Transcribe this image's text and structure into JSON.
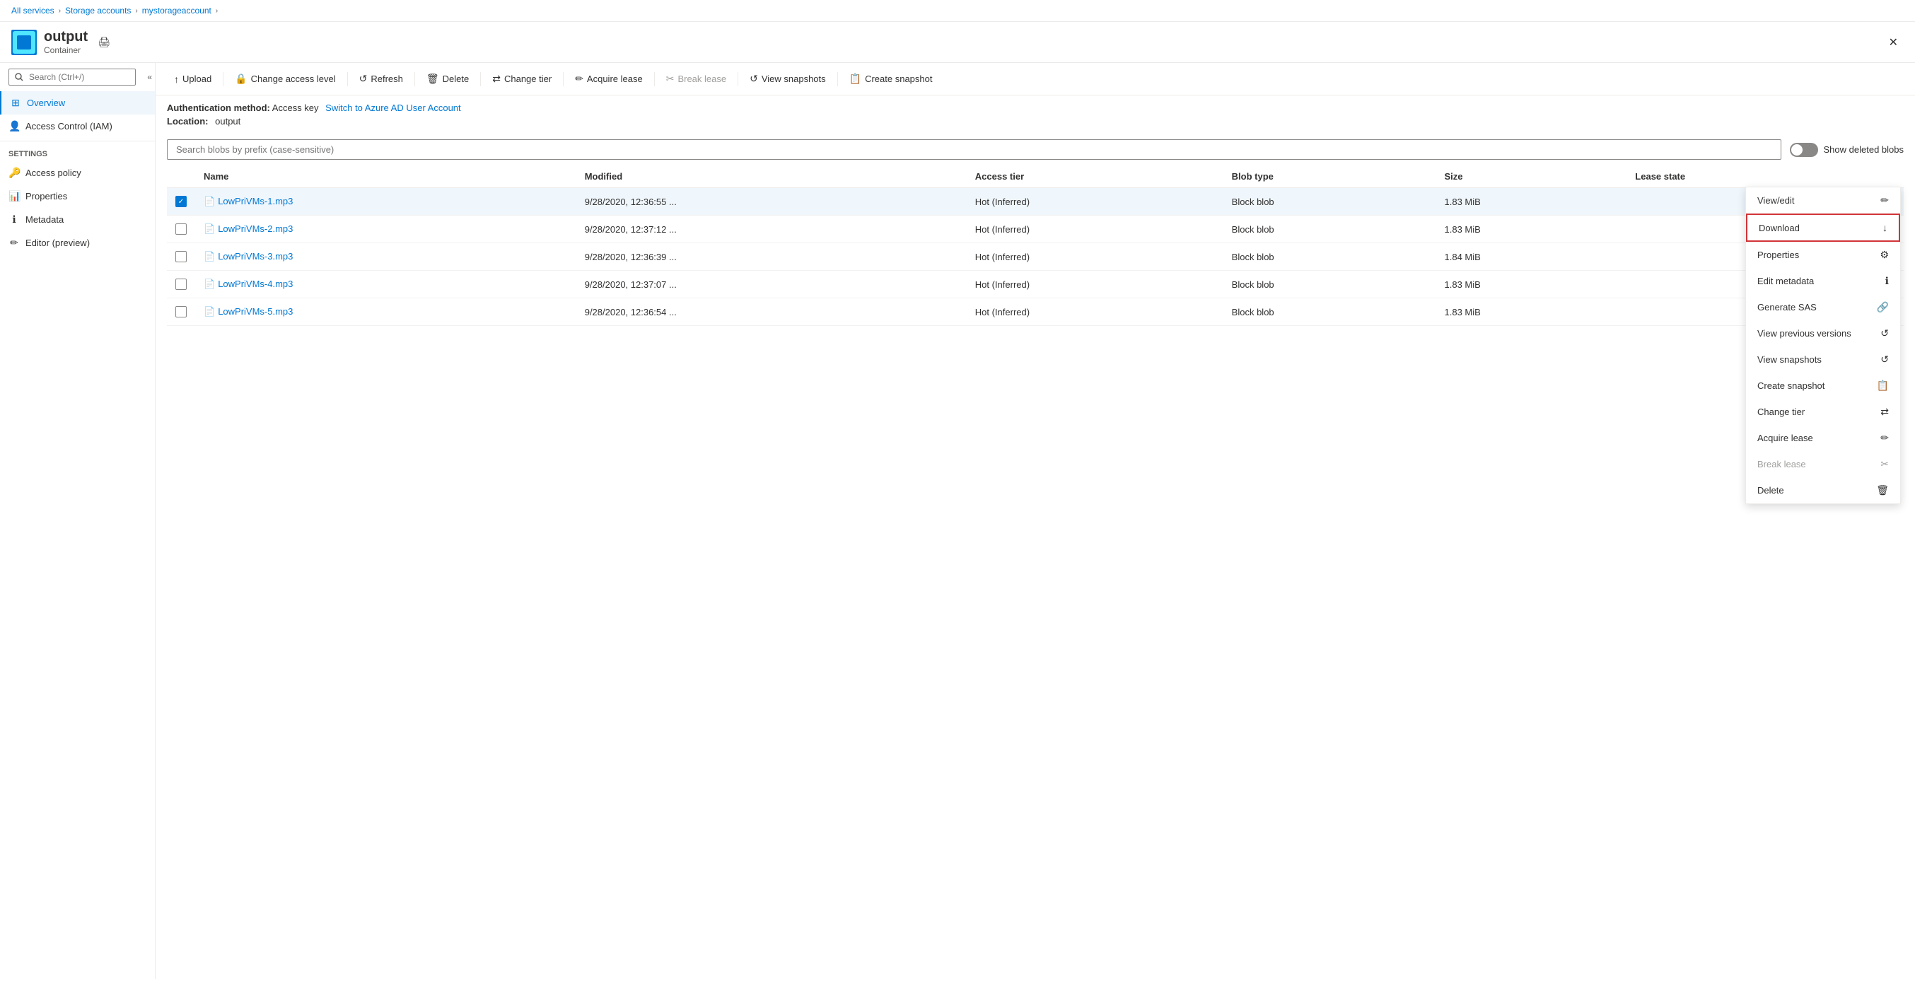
{
  "breadcrumb": {
    "items": [
      "All services",
      "Storage accounts",
      "mystorageaccount"
    ],
    "separators": [
      ">",
      ">",
      ">"
    ]
  },
  "header": {
    "title": "output",
    "subtitle": "Container",
    "close_label": "✕"
  },
  "sidebar": {
    "search_placeholder": "Search (Ctrl+/)",
    "collapse_icon": "«",
    "nav_items": [
      {
        "id": "overview",
        "label": "Overview",
        "icon": "⊞",
        "active": true
      },
      {
        "id": "iam",
        "label": "Access Control (IAM)",
        "icon": "👤"
      }
    ],
    "settings_label": "Settings",
    "settings_items": [
      {
        "id": "access-policy",
        "label": "Access policy",
        "icon": "🔑"
      },
      {
        "id": "properties",
        "label": "Properties",
        "icon": "📊"
      },
      {
        "id": "metadata",
        "label": "Metadata",
        "icon": "ℹ"
      },
      {
        "id": "editor",
        "label": "Editor (preview)",
        "icon": "✏"
      }
    ]
  },
  "toolbar": {
    "buttons": [
      {
        "id": "upload",
        "label": "Upload",
        "icon": "↑",
        "disabled": false
      },
      {
        "id": "change-access",
        "label": "Change access level",
        "icon": "🔒",
        "disabled": false
      },
      {
        "id": "refresh",
        "label": "Refresh",
        "icon": "↺",
        "disabled": false
      },
      {
        "id": "delete",
        "label": "Delete",
        "icon": "🗑",
        "disabled": false
      },
      {
        "id": "change-tier",
        "label": "Change tier",
        "icon": "⇄",
        "disabled": false
      },
      {
        "id": "acquire-lease",
        "label": "Acquire lease",
        "icon": "✏",
        "disabled": false
      },
      {
        "id": "break-lease",
        "label": "Break lease",
        "icon": "✂",
        "disabled": true
      },
      {
        "id": "view-snapshots",
        "label": "View snapshots",
        "icon": "↺",
        "disabled": false
      },
      {
        "id": "create-snapshot",
        "label": "Create snapshot",
        "icon": "📋",
        "disabled": false
      }
    ]
  },
  "info": {
    "auth_label": "Authentication method:",
    "auth_value": "Access key",
    "auth_link": "Switch to Azure AD User Account",
    "location_label": "Location:",
    "location_value": "output"
  },
  "blob_search": {
    "placeholder": "Search blobs by prefix (case-sensitive)",
    "show_deleted_label": "Show deleted blobs"
  },
  "table": {
    "columns": [
      "Name",
      "Modified",
      "Access tier",
      "Blob type",
      "Size",
      "Lease state"
    ],
    "rows": [
      {
        "name": "LowPriVMs-1.mp3",
        "modified": "9/28/2020, 12:36:55 ...",
        "access_tier": "Hot (Inferred)",
        "blob_type": "Block blob",
        "size": "1.83 MiB",
        "lease_state": "",
        "selected": true
      },
      {
        "name": "LowPriVMs-2.mp3",
        "modified": "9/28/2020, 12:37:12 ...",
        "access_tier": "Hot (Inferred)",
        "blob_type": "Block blob",
        "size": "1.83 MiB",
        "lease_state": "",
        "selected": false
      },
      {
        "name": "LowPriVMs-3.mp3",
        "modified": "9/28/2020, 12:36:39 ...",
        "access_tier": "Hot (Inferred)",
        "blob_type": "Block blob",
        "size": "1.84 MiB",
        "lease_state": "",
        "selected": false
      },
      {
        "name": "LowPriVMs-4.mp3",
        "modified": "9/28/2020, 12:37:07 ...",
        "access_tier": "Hot (Inferred)",
        "blob_type": "Block blob",
        "size": "1.83 MiB",
        "lease_state": "",
        "selected": false
      },
      {
        "name": "LowPriVMs-5.mp3",
        "modified": "9/28/2020, 12:36:54 ...",
        "access_tier": "Hot (Inferred)",
        "blob_type": "Block blob",
        "size": "1.83 MiB",
        "lease_state": "",
        "selected": false
      }
    ]
  },
  "context_menu": {
    "items": [
      {
        "id": "view-edit",
        "label": "View/edit",
        "icon": "✏",
        "disabled": false,
        "highlighted": false
      },
      {
        "id": "download",
        "label": "Download",
        "icon": "↓",
        "disabled": false,
        "highlighted": true
      },
      {
        "id": "properties",
        "label": "Properties",
        "icon": "⚙",
        "disabled": false,
        "highlighted": false
      },
      {
        "id": "edit-metadata",
        "label": "Edit metadata",
        "icon": "ℹ",
        "disabled": false,
        "highlighted": false
      },
      {
        "id": "generate-sas",
        "label": "Generate SAS",
        "icon": "🔗",
        "disabled": false,
        "highlighted": false
      },
      {
        "id": "view-previous",
        "label": "View previous versions",
        "icon": "↺",
        "disabled": false,
        "highlighted": false
      },
      {
        "id": "view-snapshots",
        "label": "View snapshots",
        "icon": "↺",
        "disabled": false,
        "highlighted": false
      },
      {
        "id": "create-snapshot",
        "label": "Create snapshot",
        "icon": "📋",
        "disabled": false,
        "highlighted": false
      },
      {
        "id": "change-tier",
        "label": "Change tier",
        "icon": "⇄",
        "disabled": false,
        "highlighted": false
      },
      {
        "id": "acquire-lease",
        "label": "Acquire lease",
        "icon": "✏",
        "disabled": false,
        "highlighted": false
      },
      {
        "id": "break-lease",
        "label": "Break lease",
        "icon": "✂",
        "disabled": true,
        "highlighted": false
      },
      {
        "id": "delete",
        "label": "Delete",
        "icon": "🗑",
        "disabled": false,
        "highlighted": false
      }
    ]
  },
  "colors": {
    "accent": "#0078d4",
    "highlight_border": "#d13438",
    "disabled": "#a19f9d"
  }
}
